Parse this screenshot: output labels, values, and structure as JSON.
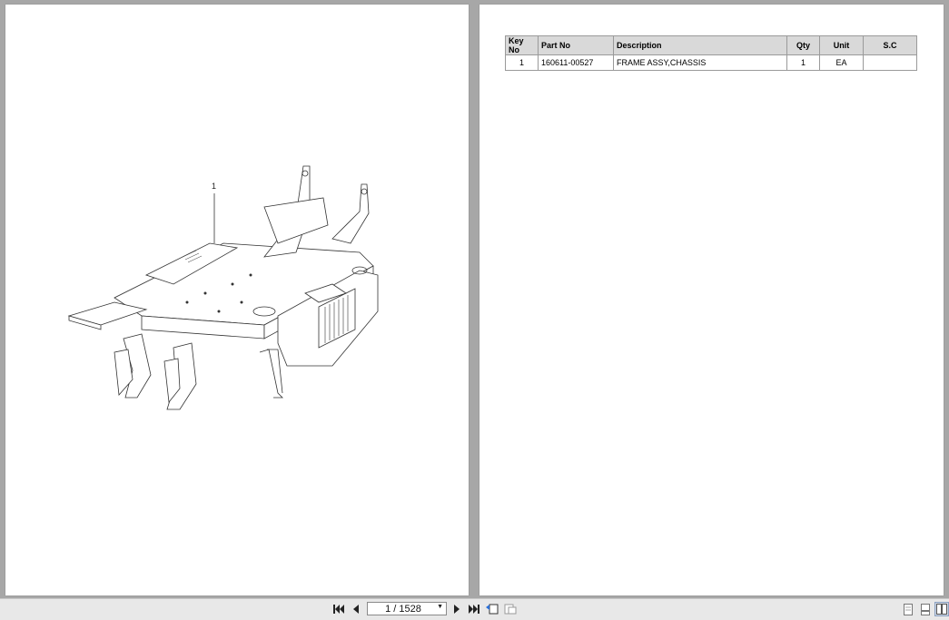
{
  "drawing": {
    "callout_label": "1"
  },
  "parts_table": {
    "headers": [
      "Key No",
      "Part No",
      "Description",
      "Qty",
      "Unit",
      "S.C"
    ],
    "rows": [
      {
        "key_no": "1",
        "part_no": "160611-00527",
        "description": "FRAME ASSY,CHASSIS",
        "qty": "1",
        "unit": "EA",
        "sc": ""
      }
    ]
  },
  "toolbar": {
    "page_indicator": "1 / 1528",
    "icons": [
      "first-page-icon",
      "previous-page-icon",
      "next-page-icon",
      "last-page-icon",
      "previous-view-icon",
      "next-view-icon",
      "single-page-view-icon",
      "continuous-view-icon",
      "two-page-view-icon"
    ]
  }
}
